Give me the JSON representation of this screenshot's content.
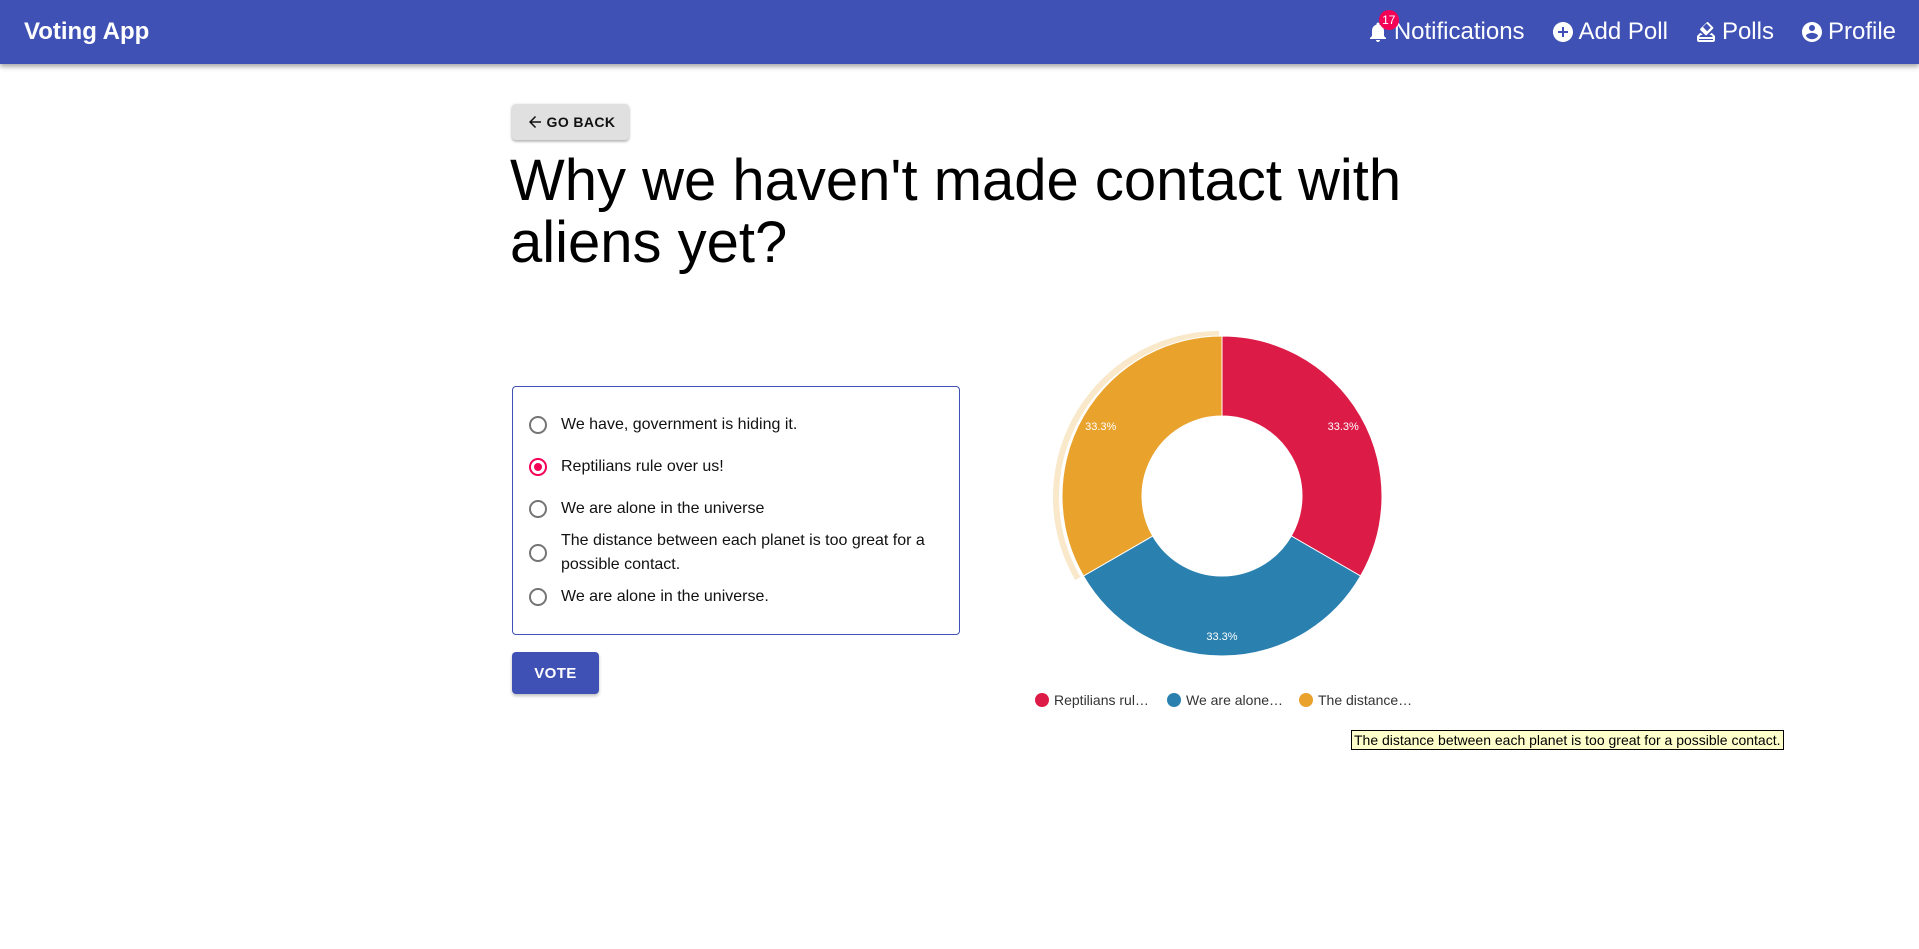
{
  "app": {
    "title": "Voting App"
  },
  "nav": {
    "notifications": {
      "label": "Notifications",
      "badge": "17",
      "icon": "bell-icon"
    },
    "add_poll": {
      "label": "Add Poll",
      "icon": "add-circle-icon"
    },
    "polls": {
      "label": "Polls",
      "icon": "ballot-icon"
    },
    "profile": {
      "label": "Profile",
      "icon": "account-circle-icon"
    }
  },
  "back_button": {
    "label": "GO BACK",
    "icon": "arrow-left-icon"
  },
  "poll": {
    "question": "Why we haven't made contact with aliens yet?",
    "options": [
      {
        "label": "We have, government is hiding it.",
        "selected": false
      },
      {
        "label": "Reptilians rule over us!",
        "selected": true
      },
      {
        "label": "We are alone in the universe",
        "selected": false
      },
      {
        "label": "The distance between each planet is too great for a possible contact.",
        "selected": false
      },
      {
        "label": "We are alone in the universe.",
        "selected": false
      }
    ],
    "vote_label": "VOTE"
  },
  "colors": {
    "appbar": "#3f51b5",
    "accent": "#f50057",
    "slice_red": "#dc1c47",
    "slice_blue": "#2a80af",
    "slice_orange": "#e9a22c"
  },
  "chart_data": {
    "type": "pie",
    "donut": true,
    "categories": [
      "Reptilians rule over us!",
      "We are alone in the universe",
      "The distance between each planet is too great for a possible contact."
    ],
    "legend_labels": [
      "Reptilians rul…",
      "We are alone…",
      "The distance…"
    ],
    "values": [
      1,
      1,
      1
    ],
    "data_labels": [
      "33.3%",
      "33.3%",
      "33.3%"
    ],
    "colors": [
      "#dc1c47",
      "#2a80af",
      "#e9a22c"
    ],
    "highlighted_index": 2,
    "legend_position": "bottom"
  },
  "tooltip": {
    "text": "The distance between each planet is too great for a possible contact."
  }
}
